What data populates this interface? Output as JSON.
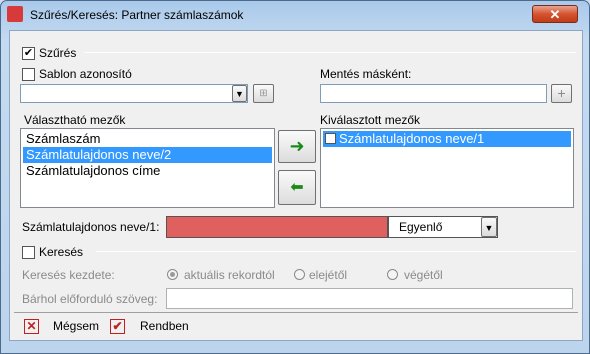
{
  "window": {
    "title": "Szűrés/Keresés: Partner számlaszámok",
    "close_glyph": "✕"
  },
  "filter": {
    "group_label": "Szűrés",
    "group_checked": true,
    "template_label": "Sablon azonosító",
    "template_value": "",
    "save_as_label": "Mentés másként:",
    "save_as_value": "",
    "add_glyph": "+"
  },
  "fields": {
    "available_label": "Választható mezők",
    "available_items": [
      "Számlaszám",
      "Számlatulajdonos neve/2",
      "Számlatulajdonos címe"
    ],
    "available_selected_index": 1,
    "selected_label": "Kiválasztott mezők",
    "selected_items": [
      "Számlatulajdonos neve/1"
    ],
    "add_arrow": "➜",
    "remove_arrow": "⬅"
  },
  "condition": {
    "field_label": "Számlatulajdonos neve/1:",
    "value": "",
    "operator": "Egyenlő",
    "value_color": "#e06060"
  },
  "search": {
    "group_label": "Keresés",
    "start_label": "Keresés kezdete:",
    "options": [
      "aktuális rekordtól",
      "elejétől",
      "végétől"
    ],
    "selected_option_index": 0,
    "text_label": "Bárhol előforduló szöveg:",
    "text_value": ""
  },
  "footer": {
    "cancel_label": "Mégsem",
    "ok_label": "Rendben"
  }
}
